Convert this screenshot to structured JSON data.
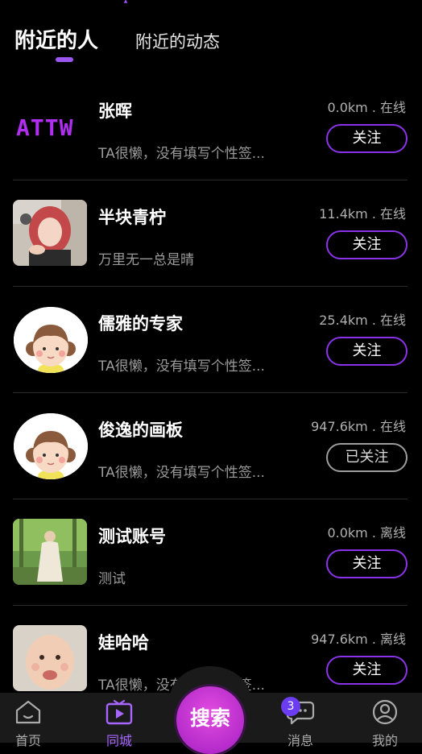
{
  "header": {
    "tabs": [
      {
        "label": "附近的人",
        "active": true
      },
      {
        "label": "附近的动态",
        "active": false
      }
    ]
  },
  "users": [
    {
      "name": "张晖",
      "signature": "TA很懒，没有填写个性签...",
      "distance": "0.0km . 在线",
      "follow_label": "关注",
      "followed": false,
      "avatar": "attw-logo"
    },
    {
      "name": "半块青柠",
      "signature": "万里无一总是晴",
      "distance": "11.4km . 在线",
      "follow_label": "关注",
      "followed": false,
      "avatar": "photo-girl-red-hair"
    },
    {
      "name": "儒雅的专家",
      "signature": "TA很懒，没有填写个性签...",
      "distance": "25.4km . 在线",
      "follow_label": "关注",
      "followed": false,
      "avatar": "cartoon-girl"
    },
    {
      "name": "俊逸的画板",
      "signature": "TA很懒，没有填写个性签...",
      "distance": "947.6km . 在线",
      "follow_label": "已关注",
      "followed": true,
      "avatar": "cartoon-girl"
    },
    {
      "name": "测试账号",
      "signature": "测试",
      "distance": "0.0km . 离线",
      "follow_label": "关注",
      "followed": false,
      "avatar": "photo-outdoor-woman"
    },
    {
      "name": "娃哈哈",
      "signature": "TA很懒，没有填写个性签...",
      "distance": "947.6km . 离线",
      "follow_label": "关注",
      "followed": false,
      "avatar": "photo-baby"
    }
  ],
  "logo_text": "ATTW",
  "tabbar": {
    "home_label": "首页",
    "city_label": "同城",
    "search_label": "搜索",
    "messages_label": "消息",
    "messages_badge": "3",
    "me_label": "我的"
  },
  "colors": {
    "accent": "#8a33e8",
    "active_tab": "#a766ff",
    "search_button": "#c530d8"
  }
}
